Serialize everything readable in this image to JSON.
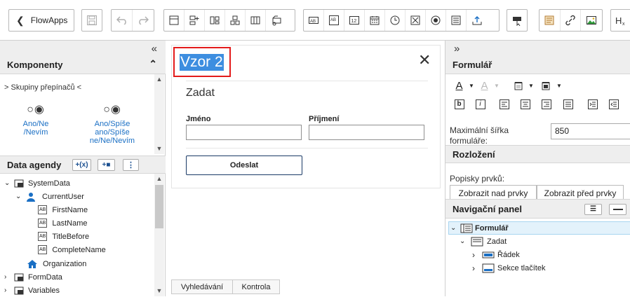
{
  "toolbar": {
    "back_label": "FlowApps"
  },
  "left": {
    "components": {
      "title": "Komponenty",
      "category": "Skupiny přepínačů",
      "items": [
        {
          "label": "Ano/Ne\n/Nevím"
        },
        {
          "label": "Ano/Spíše\nano/Spíše\nne/Ne/Nevím"
        }
      ]
    },
    "agenda": {
      "title": "Data agendy",
      "tree": [
        {
          "label": "SystemData"
        },
        {
          "label": "CurrentUser"
        },
        {
          "label": "FirstName"
        },
        {
          "label": "LastName"
        },
        {
          "label": "TitleBefore"
        },
        {
          "label": "CompleteName"
        },
        {
          "label": "Organization"
        },
        {
          "label": "FormData"
        },
        {
          "label": "Variables"
        }
      ]
    }
  },
  "center": {
    "form_title": "Vzor 2",
    "section_title": "Zadat",
    "fields": [
      {
        "label": "Jméno",
        "value": ""
      },
      {
        "label": "Příjmení",
        "value": ""
      }
    ],
    "submit_label": "Odeslat",
    "tabs": [
      {
        "label": "Vyhledávání"
      },
      {
        "label": "Kontrola"
      }
    ]
  },
  "right": {
    "formular": {
      "title": "Formulář",
      "max_width_label": "Maximální šířka formuláře:",
      "max_width_value": "850"
    },
    "layout": {
      "title": "Rozložení",
      "labels_title": "Popisky prvků:",
      "btn_above": "Zobrazit nad prvky",
      "btn_before": "Zobrazit před prvky"
    },
    "nav": {
      "title": "Navigační panel",
      "tree": [
        {
          "label": "Formulář"
        },
        {
          "label": "Zadat"
        },
        {
          "label": "Řádek"
        },
        {
          "label": "Sekce tlačítek"
        }
      ]
    }
  },
  "colors": {
    "accent": "#1a6fc4",
    "selection": "#3d8ee0",
    "highlight_border": "#e31b1b"
  }
}
